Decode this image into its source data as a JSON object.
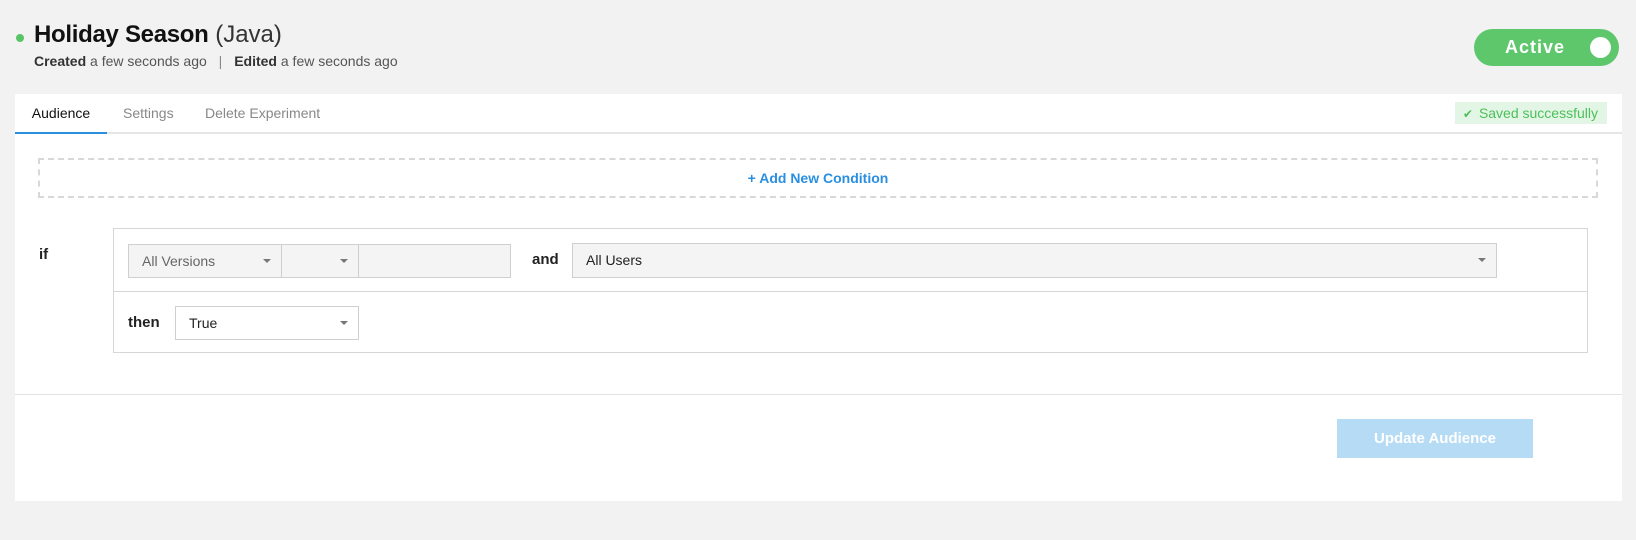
{
  "header": {
    "title": "Holiday Season",
    "language": "(Java)",
    "created_label": "Created",
    "created_value": "a few seconds ago",
    "separator": "|",
    "edited_label": "Edited",
    "edited_value": "a few seconds ago",
    "toggle_label": "Active",
    "status_color": "#5ec76c"
  },
  "tabs": [
    {
      "label": "Audience",
      "active": true
    },
    {
      "label": "Settings",
      "active": false
    },
    {
      "label": "Delete Experiment",
      "active": false
    }
  ],
  "saved_badge": {
    "icon": "check-icon",
    "text": "Saved successfully"
  },
  "add_condition": {
    "label": "+ Add New Condition"
  },
  "rule": {
    "if_label": "if",
    "version_select": "All Versions",
    "operator_select": "",
    "version_input": "",
    "and_label": "and",
    "audience_select": "All Users",
    "then_label": "then",
    "value_select": "True"
  },
  "footer": {
    "update_button": "Update Audience"
  },
  "colors": {
    "accent": "#2a8fe0",
    "success": "#4bbf5a",
    "button_disabled": "#b6dbf5"
  }
}
